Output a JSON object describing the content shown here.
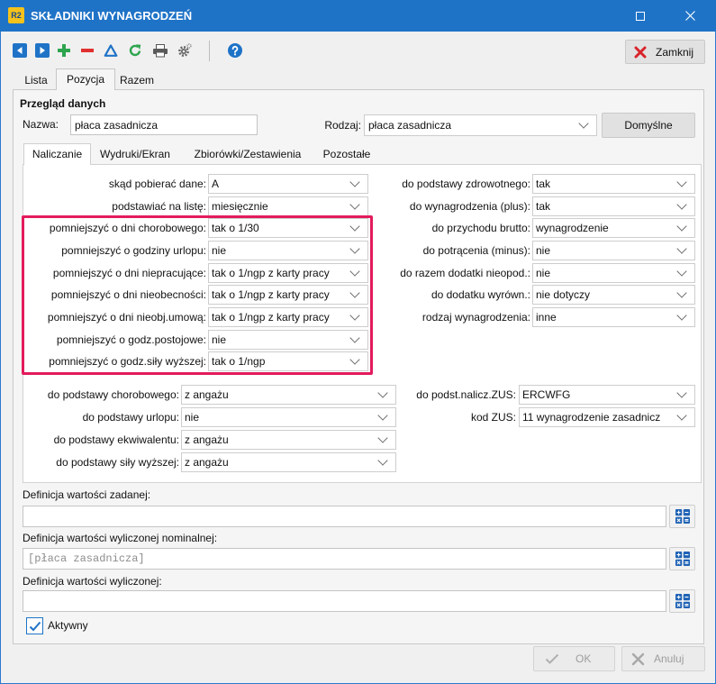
{
  "window": {
    "logo_text": "R2",
    "title": "SKŁADNIKI WYNAGRODZEŃ",
    "controls": [
      "maximize-icon",
      "close-icon"
    ]
  },
  "toolbar": {
    "icons": [
      "arrow-left-icon",
      "arrow-right-icon",
      "plus-icon",
      "minus-icon",
      "triangle-icon",
      "refresh-icon",
      "printer-icon",
      "gear-icon",
      "help-icon"
    ],
    "close_label": "Zamknij",
    "close_icon": "close-red-icon"
  },
  "tabs": [
    {
      "label": "Lista",
      "selected": false
    },
    {
      "label": "Pozycja",
      "selected": true
    },
    {
      "label": "Razem",
      "selected": false
    }
  ],
  "overview": {
    "title": "Przegląd danych",
    "name_label": "Nazwa:",
    "name_value": "płaca zasadnicza",
    "type_label": "Rodzaj:",
    "type_value": "płaca zasadnicza",
    "defaults_label": "Domyślne"
  },
  "subtabs": [
    {
      "label": "Naliczanie",
      "selected": true
    },
    {
      "label": "Wydruki/Ekran",
      "selected": false
    },
    {
      "label": "Zbiorówki/Zestawienia",
      "selected": false
    },
    {
      "label": "Pozostałe",
      "selected": false
    }
  ],
  "calc": {
    "left": [
      {
        "label": "skąd pobierać dane:",
        "value": "A"
      },
      {
        "label": "podstawiać na listę:",
        "value": "miesięcznie"
      },
      {
        "label": "pomniejszyć o dni chorobowego:",
        "value": "tak o 1/30"
      },
      {
        "label": "pomniejszyć o godziny urlopu:",
        "value": "nie"
      },
      {
        "label": "pomniejszyć o dni niepracujące:",
        "value": "tak o 1/ngp z karty pracy"
      },
      {
        "label": "pomniejszyć o dni nieobecności:",
        "value": "tak o 1/ngp z karty pracy"
      },
      {
        "label": "pomniejszyć o dni nieobj.umową:",
        "value": "tak o 1/ngp z karty pracy"
      },
      {
        "label": "pomniejszyć o godz.postojowe:",
        "value": "nie"
      },
      {
        "label": "pomniejszyć o godz.siły wyższej:",
        "value": "tak o 1/ngp"
      }
    ],
    "right": [
      {
        "label": "do podstawy zdrowotnego:",
        "value": "tak"
      },
      {
        "label": "do wynagrodzenia (plus):",
        "value": "tak"
      },
      {
        "label": "do przychodu brutto:",
        "value": "wynagrodzenie"
      },
      {
        "label": "do potrącenia (minus):",
        "value": "nie"
      },
      {
        "label": "do razem dodatki nieopod.:",
        "value": "nie"
      },
      {
        "label": "do dodatku wyrówn.:",
        "value": "nie dotyczy"
      },
      {
        "label": "rodzaj wynagrodzenia:",
        "value": "inne"
      }
    ],
    "lower_left": [
      {
        "label": "do podstawy chorobowego:",
        "value": "z angażu"
      },
      {
        "label": "do podstawy urlopu:",
        "value": "nie"
      },
      {
        "label": "do podstawy ekwiwalentu:",
        "value": "z angażu"
      },
      {
        "label": "do podstawy siły wyższej:",
        "value": "z angażu"
      }
    ],
    "lower_right": [
      {
        "label": "do podst.nalicz.ZUS:",
        "value": "ERCWFG"
      },
      {
        "label": "kod ZUS:",
        "value": "11 wynagrodzenie zasadnicz"
      }
    ]
  },
  "definitions": [
    {
      "label": "Definicja wartości zadanej:",
      "value": "",
      "button_icon": "formula-grid-icon"
    },
    {
      "label": "Definicja wartości wyliczonej nominalnej:",
      "value": "[płaca zasadnicza]",
      "button_icon": "formula-grid-icon"
    },
    {
      "label": "Definicja wartości wyliczonej:",
      "value": "",
      "button_icon": "formula-grid-icon"
    }
  ],
  "active": {
    "label": "Aktywny",
    "checked": true
  },
  "footer": {
    "ok_label": "OK",
    "ok_icon": "check-icon",
    "ok_enabled": false,
    "cancel_label": "Anuluj",
    "cancel_icon": "close-icon",
    "cancel_enabled": false
  },
  "colors": {
    "title_bar": "#1f73c7",
    "highlight": "#e31b5c",
    "accent": "#1f73c7"
  }
}
